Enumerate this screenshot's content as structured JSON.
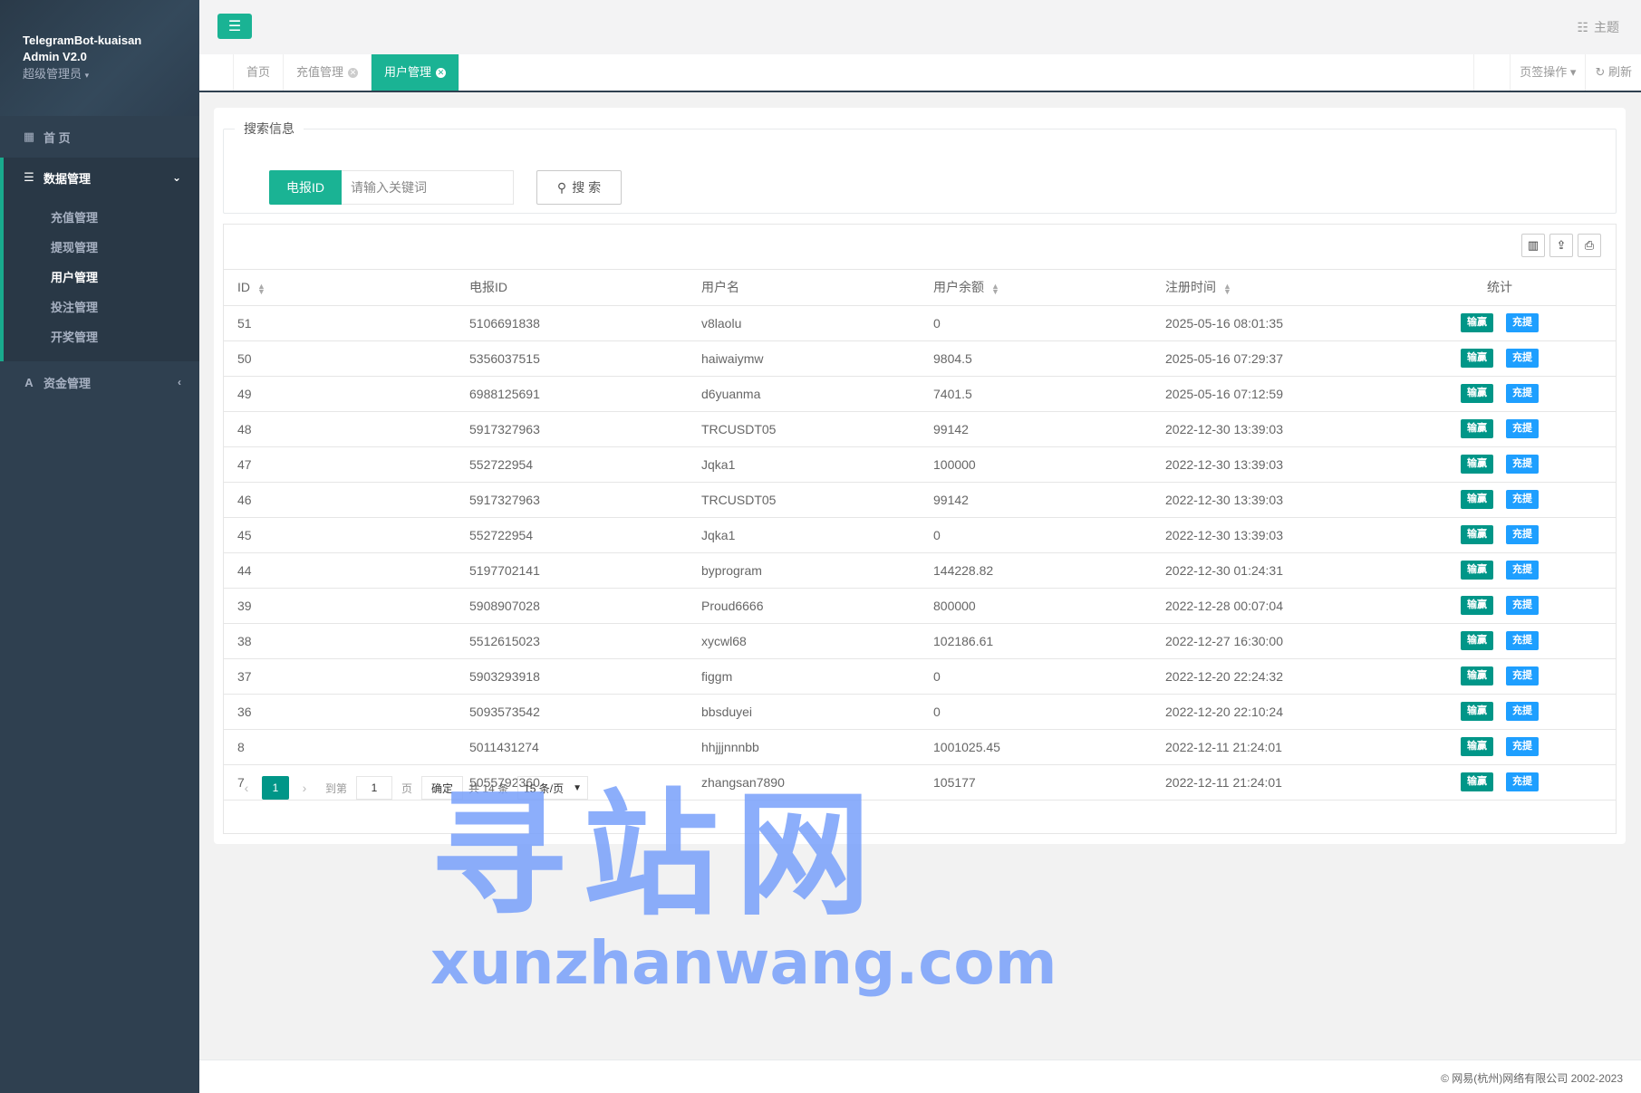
{
  "sidebar": {
    "brand_line1": "TelegramBot-kuaisan",
    "brand_line2": "Admin V2.0",
    "role": "超级管理员",
    "home": "首 页",
    "group_label": "数据管理",
    "sub_items": [
      {
        "label": "充值管理"
      },
      {
        "label": "提现管理"
      },
      {
        "label": "用户管理"
      },
      {
        "label": "投注管理"
      },
      {
        "label": "开奖管理"
      }
    ],
    "funds": "资金管理"
  },
  "topbar": {
    "theme_label": "主题"
  },
  "tabs": {
    "items": [
      {
        "label": "首页"
      },
      {
        "label": "充值管理"
      },
      {
        "label": "用户管理"
      }
    ],
    "page_ops": "页签操作",
    "refresh": "刷新"
  },
  "search": {
    "legend": "搜索信息",
    "field_label": "电报ID",
    "placeholder": "请输入关键词",
    "button": "搜 索"
  },
  "table": {
    "headers": {
      "id": "ID",
      "tg_id": "电报ID",
      "username": "用户名",
      "balance": "用户余额",
      "reg_time": "注册时间",
      "stats": "统计"
    },
    "action_win": "输赢",
    "action_topup": "充提",
    "rows": [
      {
        "id": "51",
        "tg_id": "5106691838",
        "username": "v8laolu",
        "balance": "0",
        "reg_time": "2025-05-16 08:01:35"
      },
      {
        "id": "50",
        "tg_id": "5356037515",
        "username": "haiwaiymw",
        "balance": "9804.5",
        "reg_time": "2025-05-16 07:29:37"
      },
      {
        "id": "49",
        "tg_id": "6988125691",
        "username": "d6yuanma",
        "balance": "7401.5",
        "reg_time": "2025-05-16 07:12:59"
      },
      {
        "id": "48",
        "tg_id": "5917327963",
        "username": "TRCUSDT05",
        "balance": "99142",
        "reg_time": "2022-12-30 13:39:03"
      },
      {
        "id": "47",
        "tg_id": "552722954",
        "username": "Jqka1",
        "balance": "100000",
        "reg_time": "2022-12-30 13:39:03"
      },
      {
        "id": "46",
        "tg_id": "5917327963",
        "username": "TRCUSDT05",
        "balance": "99142",
        "reg_time": "2022-12-30 13:39:03"
      },
      {
        "id": "45",
        "tg_id": "552722954",
        "username": "Jqka1",
        "balance": "0",
        "reg_time": "2022-12-30 13:39:03"
      },
      {
        "id": "44",
        "tg_id": "5197702141",
        "username": "byprogram",
        "balance": "144228.82",
        "reg_time": "2022-12-30 01:24:31"
      },
      {
        "id": "39",
        "tg_id": "5908907028",
        "username": "Proud6666",
        "balance": "800000",
        "reg_time": "2022-12-28 00:07:04"
      },
      {
        "id": "38",
        "tg_id": "5512615023",
        "username": "xycwl68",
        "balance": "102186.61",
        "reg_time": "2022-12-27 16:30:00"
      },
      {
        "id": "37",
        "tg_id": "5903293918",
        "username": "figgm",
        "balance": "0",
        "reg_time": "2022-12-20 22:24:32"
      },
      {
        "id": "36",
        "tg_id": "5093573542",
        "username": "bbsduyei",
        "balance": "0",
        "reg_time": "2022-12-20 22:10:24"
      },
      {
        "id": "8",
        "tg_id": "5011431274",
        "username": "hhjjjnnnbb",
        "balance": "1001025.45",
        "reg_time": "2022-12-11 21:24:01"
      },
      {
        "id": "7",
        "tg_id": "5055792360",
        "username": "zhangsan7890",
        "balance": "105177",
        "reg_time": "2022-12-11 21:24:01"
      }
    ]
  },
  "pager": {
    "current": "1",
    "goto_label": "到第",
    "page_value": "1",
    "page_unit": "页",
    "confirm": "确定",
    "total": "共 14 条",
    "page_size": "15 条/页"
  },
  "watermark": {
    "cn": "寻站网",
    "en": "xunzhanwang.com"
  },
  "footer": {
    "copyright": "© 网易(杭州)网络有限公司 2002-2023"
  },
  "colors": {
    "sidebar_bg": "#2f4050",
    "accent": "#1ab394",
    "btn_green": "#009688",
    "btn_blue": "#1e9fff"
  }
}
